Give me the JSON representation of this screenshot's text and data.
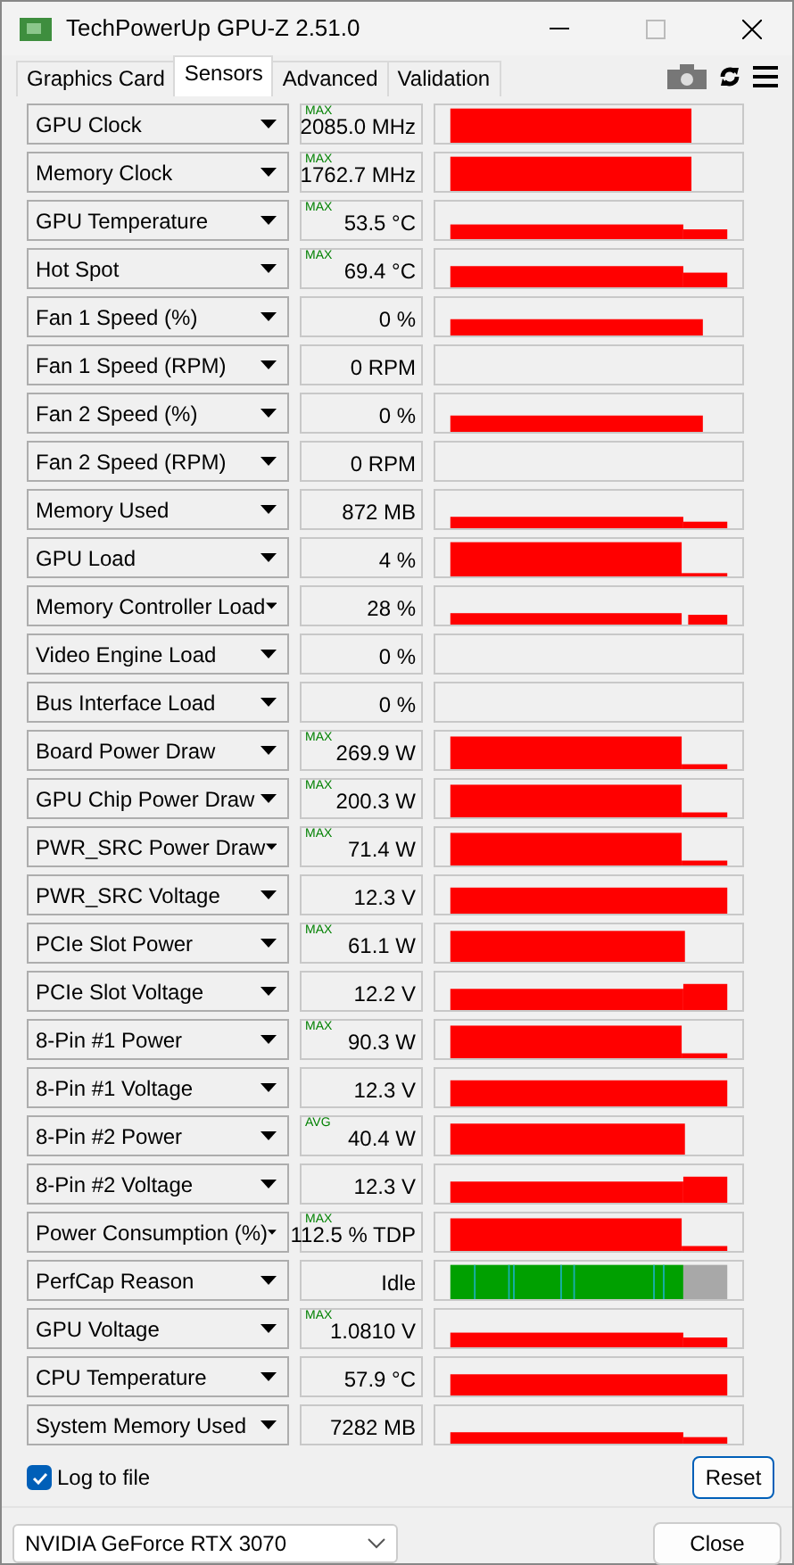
{
  "window": {
    "title": "TechPowerUp GPU-Z 2.51.0"
  },
  "tabs": [
    {
      "label": "Graphics Card",
      "selected": false
    },
    {
      "label": "Sensors",
      "selected": true
    },
    {
      "label": "Advanced",
      "selected": false
    },
    {
      "label": "Validation",
      "selected": false
    }
  ],
  "sensors": [
    {
      "name": "GPU Clock",
      "mode": "MAX",
      "value": "2085.0 MHz",
      "kind": "clock"
    },
    {
      "name": "Memory Clock",
      "mode": "MAX",
      "value": "1762.7 MHz",
      "kind": "clock"
    },
    {
      "name": "GPU Temperature",
      "mode": "MAX",
      "value": "53.5 °C",
      "kind": "temp"
    },
    {
      "name": "Hot Spot",
      "mode": "MAX",
      "value": "69.4 °C",
      "kind": "hot"
    },
    {
      "name": "Fan 1 Speed (%)",
      "value": "0 %",
      "kind": "fan"
    },
    {
      "name": "Fan 1 Speed (RPM)",
      "value": "0 RPM",
      "kind": "empty"
    },
    {
      "name": "Fan 2 Speed (%)",
      "value": "0 %",
      "kind": "fan"
    },
    {
      "name": "Fan 2 Speed (RPM)",
      "value": "0 RPM",
      "kind": "empty"
    },
    {
      "name": "Memory Used",
      "value": "872 MB",
      "kind": "memused"
    },
    {
      "name": "GPU Load",
      "value": "4 %",
      "kind": "load"
    },
    {
      "name": "Memory Controller Load",
      "value": "28 %",
      "kind": "mcload"
    },
    {
      "name": "Video Engine Load",
      "value": "0 %",
      "kind": "empty"
    },
    {
      "name": "Bus Interface Load",
      "value": "0 %",
      "kind": "empty"
    },
    {
      "name": "Board Power Draw",
      "mode": "MAX",
      "value": "269.9 W",
      "kind": "power"
    },
    {
      "name": "GPU Chip Power Draw",
      "mode": "MAX",
      "value": "200.3 W",
      "kind": "power"
    },
    {
      "name": "PWR_SRC Power Draw",
      "mode": "MAX",
      "value": "71.4 W",
      "kind": "power"
    },
    {
      "name": "PWR_SRC Voltage",
      "value": "12.3 V",
      "kind": "volt"
    },
    {
      "name": "PCIe Slot Power",
      "mode": "MAX",
      "value": "61.1 W",
      "kind": "slot"
    },
    {
      "name": "PCIe Slot Voltage",
      "value": "12.2 V",
      "kind": "voltlow"
    },
    {
      "name": "8-Pin #1 Power",
      "mode": "MAX",
      "value": "90.3 W",
      "kind": "power"
    },
    {
      "name": "8-Pin #1 Voltage",
      "value": "12.3 V",
      "kind": "volt"
    },
    {
      "name": "8-Pin #2 Power",
      "mode": "AVG",
      "value": "40.4 W",
      "kind": "slot"
    },
    {
      "name": "8-Pin #2 Voltage",
      "value": "12.3 V",
      "kind": "voltlow"
    },
    {
      "name": "Power Consumption (%)",
      "mode": "MAX",
      "value": "112.5 % TDP",
      "kind": "power"
    },
    {
      "name": "PerfCap Reason",
      "value": "Idle",
      "kind": "perfcap"
    },
    {
      "name": "GPU Voltage",
      "mode": "MAX",
      "value": "1.0810 V",
      "kind": "temp"
    },
    {
      "name": "CPU Temperature",
      "value": "57.9 °C",
      "kind": "cpu"
    },
    {
      "name": "System Memory Used",
      "value": "7282 MB",
      "kind": "memused"
    }
  ],
  "log_to_file": {
    "label": "Log to file",
    "checked": true
  },
  "reset_button": "Reset",
  "gpu_select": {
    "value": "NVIDIA GeForce RTX 3070"
  },
  "close_button": "Close"
}
